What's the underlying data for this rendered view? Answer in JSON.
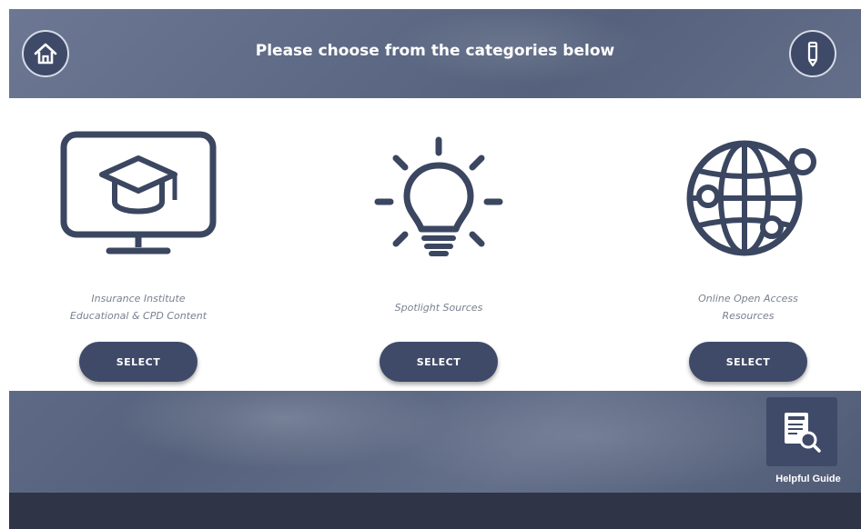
{
  "header": {
    "title": "Please choose from the categories below"
  },
  "categories": [
    {
      "icon": "monitor-graduation-cap-icon",
      "label_line1": "Insurance Institute",
      "label_line2": "Educational & CPD Content",
      "button_label": "SELECT"
    },
    {
      "icon": "lightbulb-icon",
      "label_line1": "Spotlight Sources",
      "label_line2": "",
      "button_label": "SELECT"
    },
    {
      "icon": "globe-network-icon",
      "label_line1": "Online Open Access",
      "label_line2": "Resources",
      "button_label": "SELECT"
    }
  ],
  "guide": {
    "icon": "document-search-icon",
    "label": "Helpful Guide"
  },
  "colors": {
    "primary": "#3f4a69",
    "panel": "#ffffff",
    "footer": "#2f3446"
  }
}
